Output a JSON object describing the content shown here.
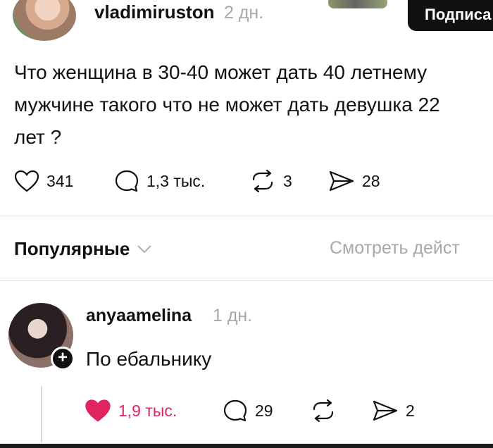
{
  "post": {
    "username": "vladimiruston",
    "time": "2 дн.",
    "subscribe_label": "Подписа",
    "text": "Что женщина в 30-40 может дать 40 летнему\nмужчине такого что не может дать девушка 22\nлет ?",
    "likes": "341",
    "comments": "1,3 тыс.",
    "reposts": "3",
    "shares": "28"
  },
  "sort": {
    "label": "Популярные",
    "view_actions": "Смотреть дейст"
  },
  "comment": {
    "username": "anyaamelina",
    "time": "1 дн.",
    "follow_symbol": "+",
    "text": "По ебальнику",
    "likes": "1,9 тыс.",
    "replies": "29",
    "reposts": "",
    "shares": "2",
    "liked_color": "#e0245e"
  }
}
